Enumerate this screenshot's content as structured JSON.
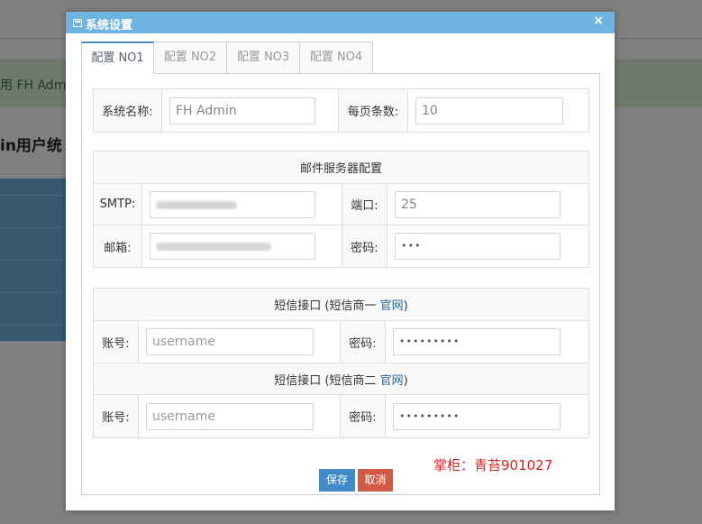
{
  "background": {
    "alert_text": "用 FH Admi",
    "heading_text": "in用户统"
  },
  "dialog": {
    "title": "系统设置",
    "close": "×",
    "tabs": [
      {
        "label": "配置 NO1",
        "active": true
      },
      {
        "label": "配置 NO2",
        "active": false
      },
      {
        "label": "配置 NO3",
        "active": false
      },
      {
        "label": "配置 NO4",
        "active": false
      }
    ],
    "basic": {
      "system_name_label": "系统名称:",
      "system_name_value": "FH Admin",
      "page_size_label": "每页条数:",
      "page_size_value": "10"
    },
    "mail": {
      "header": "邮件服务器配置",
      "smtp_label": "SMTP:",
      "port_label": "端口:",
      "port_value": "25",
      "email_label": "邮箱:",
      "password_label": "密码:",
      "password_value": "•••"
    },
    "sms1": {
      "header_prefix": "短信接口 (短信商一 ",
      "header_link": "官网",
      "header_suffix": ")",
      "account_label": "账号:",
      "account_placeholder": "username",
      "password_label": "密码:",
      "password_value": "•••••••••"
    },
    "sms2": {
      "header_prefix": "短信接口 (短信商二 ",
      "header_link": "官网",
      "header_suffix": ")",
      "account_label": "账号:",
      "account_placeholder": "username",
      "password_label": "密码:",
      "password_value": "•••••••••"
    },
    "buttons": {
      "save": "保存",
      "cancel": "取消"
    },
    "owner_note": "掌柜：青苔901027"
  },
  "colors": {
    "title_bar": "#6fb3e0",
    "save_button": "#428bca",
    "cancel_button": "#d15b47",
    "owner_note": "#e02020",
    "link": "#2a6496"
  }
}
